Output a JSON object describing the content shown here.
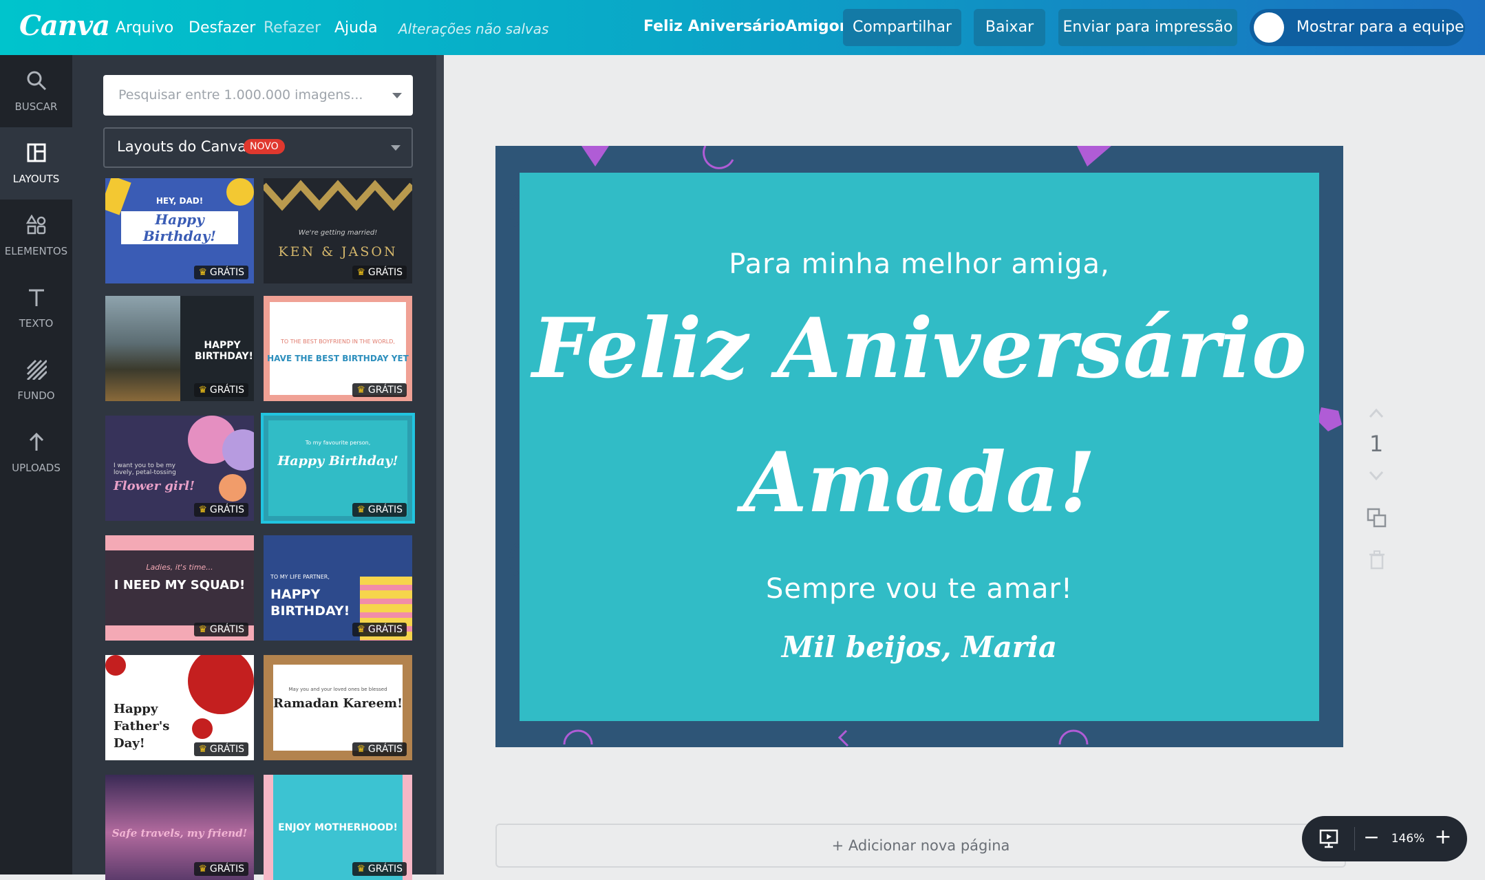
{
  "app": {
    "logo": "Canva"
  },
  "topbar": {
    "menu": [
      "Arquivo",
      "Desfazer",
      "Refazer",
      "Ajuda"
    ],
    "unsaved": "Alterações não salvas",
    "doc_title": "Feliz AniversárioAmigona!",
    "share": "Compartilhar",
    "download": "Baixar",
    "print": "Enviar para impressão",
    "team": "Mostrar para a equipe"
  },
  "rail": [
    {
      "label": "BUSCAR",
      "icon": "search-icon"
    },
    {
      "label": "LAYOUTS",
      "icon": "layouts-icon"
    },
    {
      "label": "ELEMENTOS",
      "icon": "elements-icon"
    },
    {
      "label": "TEXTO",
      "icon": "text-icon"
    },
    {
      "label": "FUNDO",
      "icon": "background-icon"
    },
    {
      "label": "UPLOADS",
      "icon": "upload-icon"
    }
  ],
  "panel": {
    "search_placeholder": "Pesquisar entre 1.000.000 imagens...",
    "layout_label": "Layouts do Canva",
    "new_badge": "NOVO",
    "badge_text": "GRÁTIS",
    "thumbs": [
      {
        "text": "Happy Birthday!",
        "sub": "HEY, DAD!"
      },
      {
        "text": "KEN & JASON",
        "sub": "We're getting married!"
      },
      {
        "text": "HAPPY BIRTHDAY!",
        "sub": ""
      },
      {
        "text": "HAVE THE BEST BIRTHDAY YET",
        "sub": "TO THE BEST BOYFRIEND IN THE WORLD,"
      },
      {
        "text": "Flower girl!",
        "sub": "I want you to be my lovely, petal-tossing"
      },
      {
        "text": "Happy Birthday!",
        "sub": "To my favourite person,"
      },
      {
        "text": "I NEED MY SQUAD!",
        "sub": "Ladies, it's time..."
      },
      {
        "text": "HAPPY BIRTHDAY!",
        "sub": "TO MY LIFE PARTNER,"
      },
      {
        "text": "Happy Father's Day!",
        "sub": ""
      },
      {
        "text": "Ramadan Kareem!",
        "sub": "May you and your loved ones be blessed"
      },
      {
        "text": "Safe travels, my friend!",
        "sub": ""
      },
      {
        "text": "ENJOY MOTHERHOOD!",
        "sub": ""
      }
    ]
  },
  "card": {
    "intro": "Para minha melhor amiga,",
    "title_line1": "Feliz Aniversário",
    "title_line2": "Amada!",
    "subtitle": "Sempre vou te amar!",
    "signature": "Mil beijos, Maria"
  },
  "page_tools": {
    "page_number": "1"
  },
  "footer": {
    "add_page": "+ Adicionar nova página",
    "zoom": "146%",
    "zoom_minus": "−",
    "zoom_plus": "+"
  },
  "colors": {
    "accent": "#00c4cc",
    "card_border": "#2e5577",
    "card_bg": "#31bcc6",
    "confetti_purple": "#b05cd6"
  }
}
